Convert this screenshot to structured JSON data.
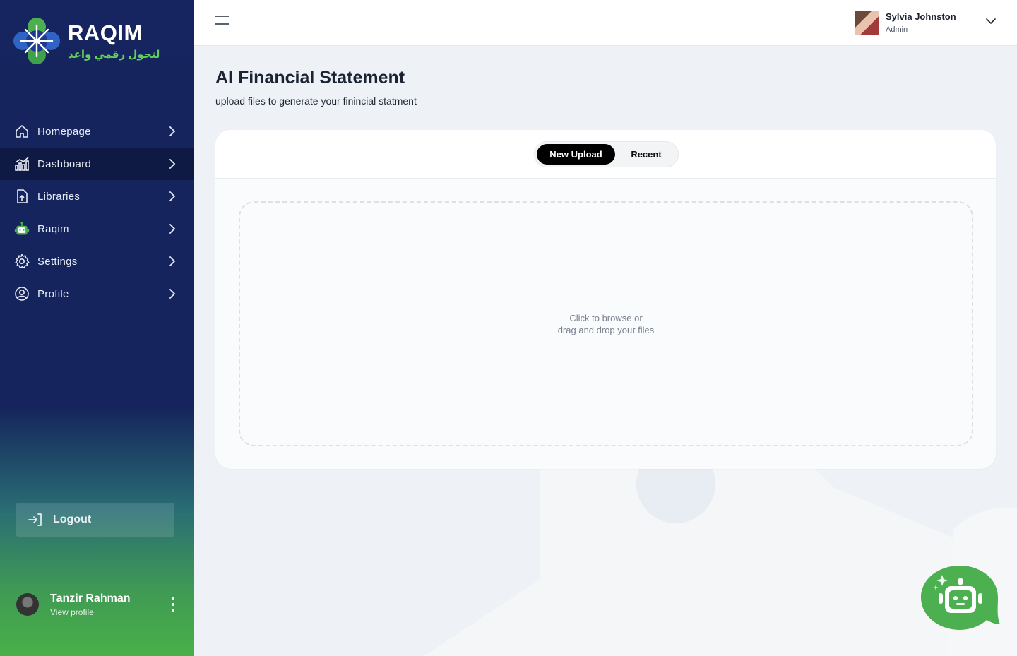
{
  "brand": {
    "name": "RAQIM",
    "tagline": "لتحول رقمي واعد"
  },
  "nav": [
    {
      "label": "Homepage",
      "icon": "home-icon",
      "active": false
    },
    {
      "label": "Dashboard",
      "icon": "dashboard-chart-icon",
      "active": true
    },
    {
      "label": "Libraries",
      "icon": "file-upload-icon",
      "active": false
    },
    {
      "label": "Raqim",
      "icon": "robot-icon",
      "active": false
    },
    {
      "label": "Settings",
      "icon": "gear-icon",
      "active": false
    },
    {
      "label": "Profile",
      "icon": "user-circle-icon",
      "active": false
    }
  ],
  "logout_label": "Logout",
  "sidebar_user": {
    "name": "Tanzir Rahman",
    "link": "View profile"
  },
  "header_user": {
    "name": "Sylvia Johnston",
    "role": "Admin"
  },
  "page": {
    "title": "AI Financial Statement",
    "subtitle": "upload files to generate your finincial statment"
  },
  "tabs": {
    "new_upload": "New Upload",
    "recent": "Recent"
  },
  "dropzone": {
    "line1": "Click to browse or",
    "line2": "drag and drop your files"
  },
  "colors": {
    "sidebar_navy": "#16245f",
    "accent_green": "#4caf50",
    "active_nav": "#0e1a44"
  }
}
